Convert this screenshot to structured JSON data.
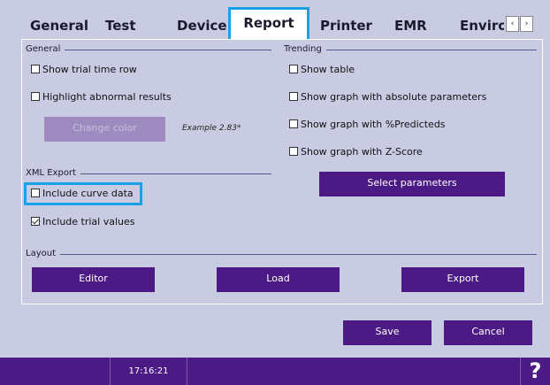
{
  "tabs": [
    {
      "label": "General"
    },
    {
      "label": "Test"
    },
    {
      "label": "Device"
    },
    {
      "label": "Report"
    },
    {
      "label": "Printer"
    },
    {
      "label": "EMR"
    },
    {
      "label": "Enviro"
    }
  ],
  "tab_scroll": {
    "left": "‹",
    "right": "›"
  },
  "general": {
    "title": "General",
    "show_trial_time_row": "Show trial time row",
    "highlight_abnormal_results": "Highlight abnormal results",
    "change_color": "Change color",
    "example": "Example 2.83*"
  },
  "trending": {
    "title": "Trending",
    "show_table": "Show table",
    "show_graph_absolute": "Show graph with absolute parameters",
    "show_graph_predicteds": "Show graph with %Predicteds",
    "show_graph_zscore": "Show graph with Z-Score",
    "select_parameters": "Select parameters"
  },
  "xml_export": {
    "title": "XML Export",
    "include_curve_data": "Include curve data",
    "include_trial_values": "Include trial values"
  },
  "layout": {
    "title": "Layout",
    "editor": "Editor",
    "load": "Load",
    "export": "Export"
  },
  "footer": {
    "save": "Save",
    "cancel": "Cancel"
  },
  "status": {
    "time": "17:16:21",
    "help": "?"
  },
  "colors": {
    "accent": "#4b1a85",
    "highlight": "#1aa0e6",
    "background": "#c9cbe3"
  }
}
